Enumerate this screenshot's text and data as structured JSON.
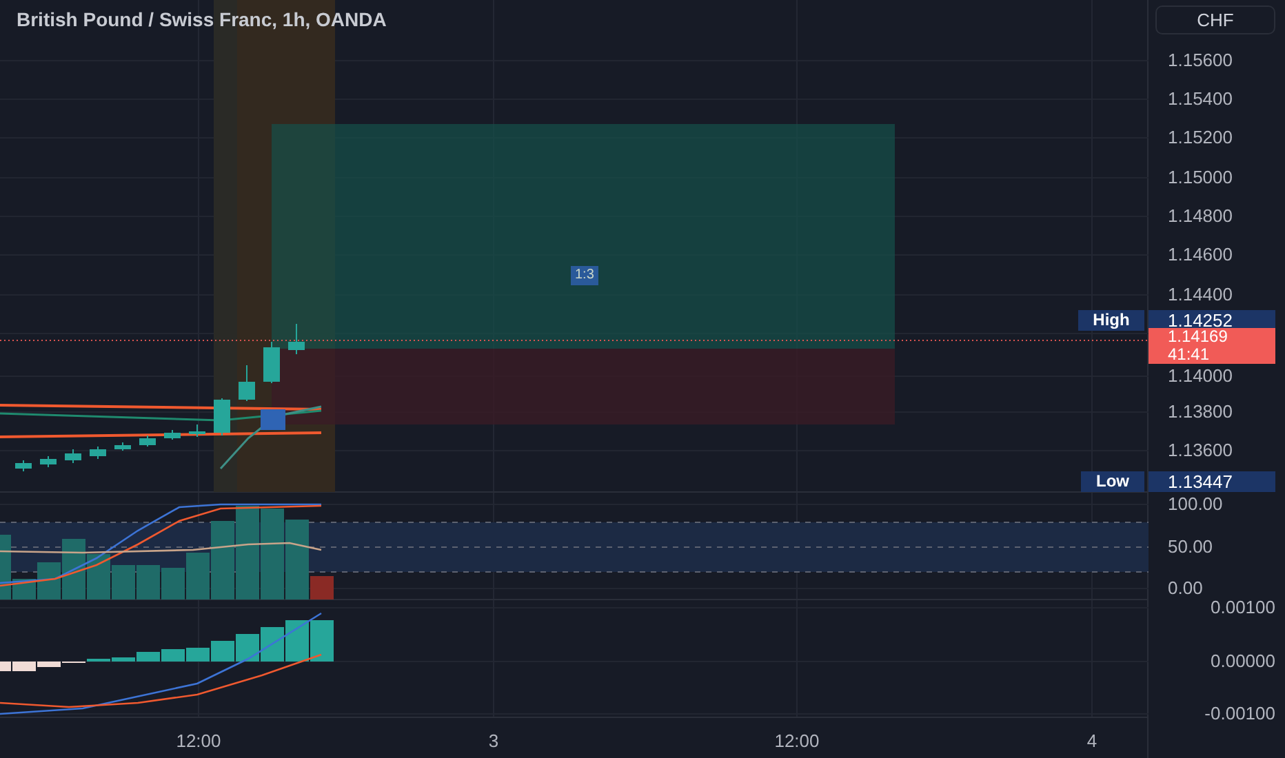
{
  "chart": {
    "title": "British Pound / Swiss Franc, 1h, OANDA",
    "ratio_label": "1:3"
  },
  "price_axis": {
    "currency_button": "CHF",
    "labels": [
      "1.15600",
      "1.15400",
      "1.15200",
      "1.15000",
      "1.14800",
      "1.14600",
      "1.14400",
      "1.14000",
      "1.13800",
      "1.13600"
    ],
    "high": {
      "tag": "High",
      "value": "1.14252"
    },
    "current": {
      "value": "1.14169",
      "countdown": "41:41"
    },
    "low": {
      "tag": "Low",
      "value": "1.13447"
    }
  },
  "oscillator_axis": {
    "labels": [
      "100.00",
      "50.00",
      "0.00"
    ]
  },
  "macd_axis": {
    "labels": [
      "0.00100",
      "0.00000",
      "-0.00100"
    ]
  },
  "time_axis": {
    "labels": [
      "12:00",
      "3",
      "12:00",
      "4"
    ]
  }
}
